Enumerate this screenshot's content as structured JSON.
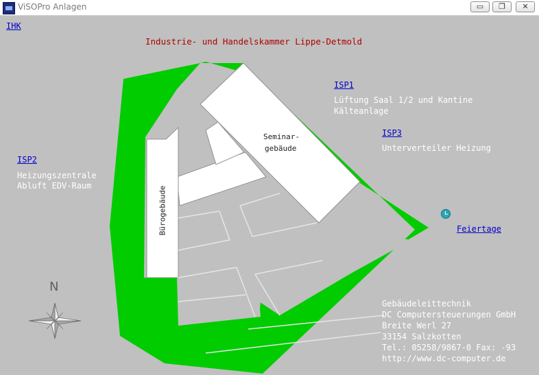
{
  "window": {
    "title": "ViSOPro Anlagen",
    "minimize_glyph": "▭",
    "restore_glyph": "❐",
    "close_glyph": "✕"
  },
  "links": {
    "ihk": "IHK",
    "isp1": "ISP1",
    "isp2": "ISP2",
    "isp3": "ISP3",
    "feiertage": "Feiertage"
  },
  "header": {
    "title": "Industrie- und Handelskammer Lippe-Detmold"
  },
  "descriptions": {
    "isp1_line1": "Lüftung Saal 1/2 und Kantine",
    "isp1_line2": "Kälteanlage",
    "isp2_line1": "Heizungszentrale",
    "isp2_line2": "Abluft EDV-Raum",
    "isp3_line1": "Unterverteiler Heizung"
  },
  "buildings": {
    "seminar_line1": "Seminar-",
    "seminar_line2": "gebäude",
    "buero": "Bürogebäude"
  },
  "compass": {
    "north_label": "N"
  },
  "company": {
    "line1": "Gebäudeleittechnik",
    "line2": "DC Computersteuerungen GmbH",
    "line3": "Breite Werl 27",
    "line4": "33154 Salzkotten",
    "line5": "Tel.: 05258/9867-0 Fax: -93",
    "line6": "http://www.dc-computer.de"
  },
  "colors": {
    "background": "#c0c0c0",
    "green": "#00cc00",
    "link": "#0000c8",
    "title_red": "#b00000",
    "building_white": "#ffffff"
  },
  "icons": {
    "app": "visopro-app-icon",
    "calendar": "clock-icon",
    "compass": "compass-rose-icon"
  }
}
